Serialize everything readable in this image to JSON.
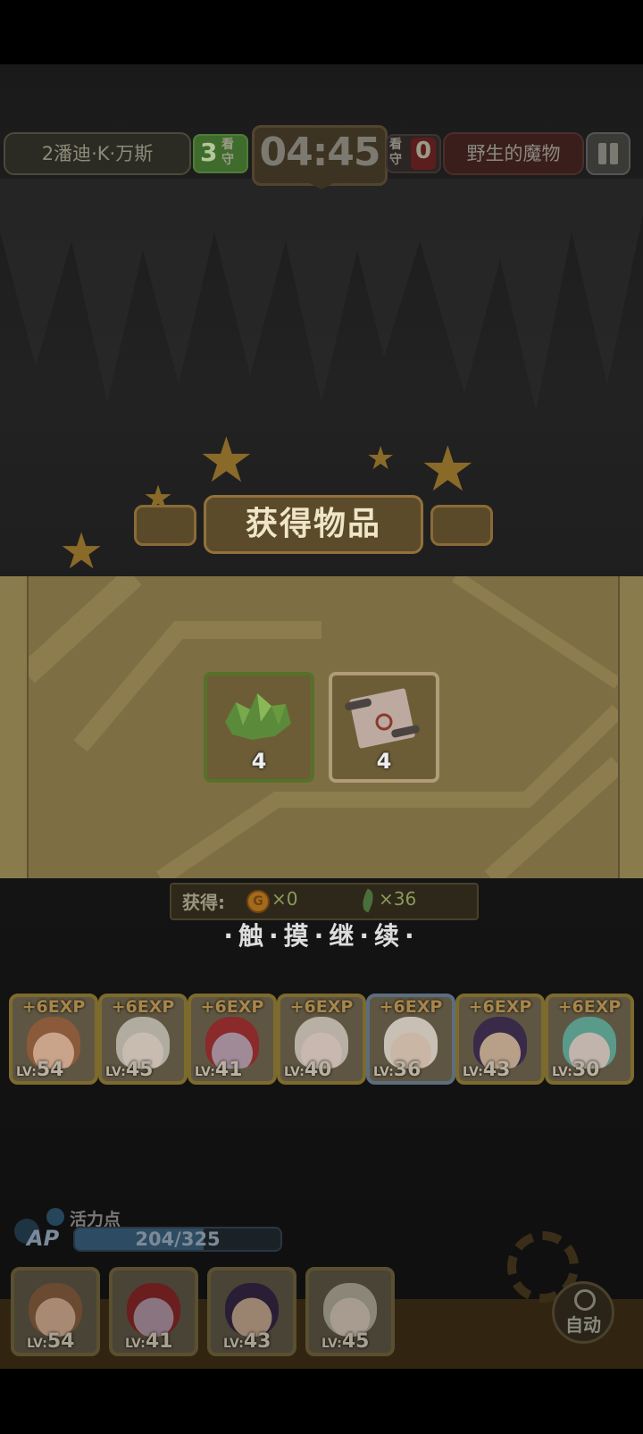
{
  "hud": {
    "left_team": "2潘迪·K·万斯",
    "left_score": "3",
    "left_score_label": "看守",
    "timer": "04:45",
    "right_score_label": "看守",
    "right_score": "0",
    "right_team": "野生的魔物",
    "pause_icon": "pause-icon"
  },
  "rewards": {
    "title": "获得物品",
    "items": [
      {
        "icon": "green-crystal-icon",
        "count": "4"
      },
      {
        "icon": "scroll-icon",
        "count": "4"
      }
    ],
    "gain_label": "获得:",
    "gold": "×0",
    "feather": "×36",
    "continue_text": "·触·摸·继·续·"
  },
  "characters": [
    {
      "exp": "+6EXP",
      "lv_prefix": "LV:",
      "lv": "54",
      "hair": "#8a5a3a",
      "skin": "#c9a48a"
    },
    {
      "exp": "+6EXP",
      "lv_prefix": "LV:",
      "lv": "45",
      "hair": "#b0aca0",
      "skin": "#c8bcb0"
    },
    {
      "exp": "+6EXP",
      "lv_prefix": "LV:",
      "lv": "41",
      "hair": "#8a2a2a",
      "skin": "#a08a98"
    },
    {
      "exp": "+6EXP",
      "lv_prefix": "LV:",
      "lv": "40",
      "hair": "#b8b0a4",
      "skin": "#c8b8b0"
    },
    {
      "exp": "+6EXP",
      "lv_prefix": "LV:",
      "lv": "36",
      "hair": "#c8c0b4",
      "skin": "#cab6a4"
    },
    {
      "exp": "+6EXP",
      "lv_prefix": "LV:",
      "lv": "43",
      "hair": "#3a2a4a",
      "skin": "#b8a088"
    },
    {
      "exp": "+6EXP",
      "lv_prefix": "LV:",
      "lv": "30",
      "hair": "#5a9a8a",
      "skin": "#c0b4ac"
    }
  ],
  "ap": {
    "title": "活力点",
    "tag": "AP",
    "value": "204/325",
    "fraction": 0.628
  },
  "party": [
    {
      "lv_prefix": "LV:",
      "lv": "54",
      "hair": "#6a4a30",
      "skin": "#a88a74"
    },
    {
      "lv_prefix": "LV:",
      "lv": "41",
      "hair": "#6a1e1e",
      "skin": "#8a7480"
    },
    {
      "lv_prefix": "LV:",
      "lv": "43",
      "hair": "#2a1e36",
      "skin": "#9a8470"
    },
    {
      "lv_prefix": "LV:",
      "lv": "45",
      "hair": "#8a8678",
      "skin": "#a89c90"
    }
  ],
  "auto_label": "自动",
  "colors": {
    "panel": "#7e6e43",
    "banner": "#5b4b2a",
    "exp_text": "#a8864a"
  }
}
